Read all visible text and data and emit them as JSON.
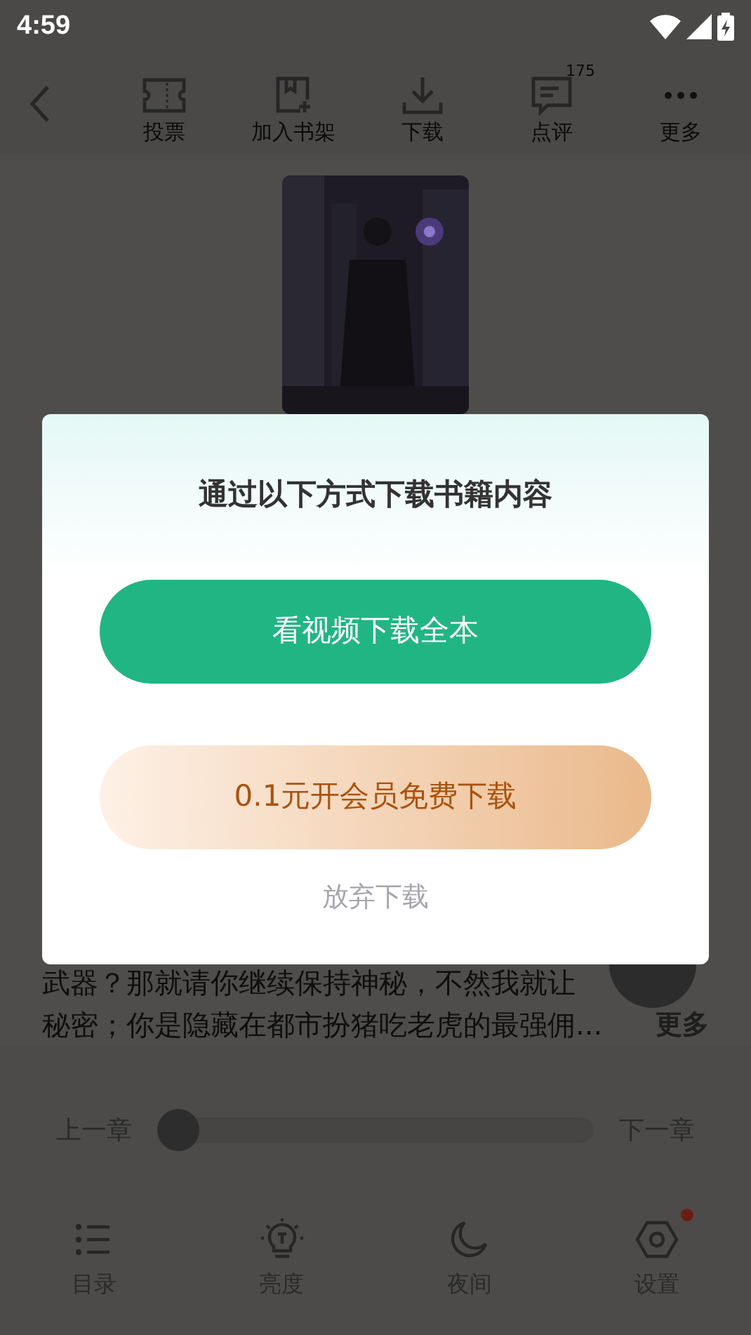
{
  "status_bar": {
    "time": "4:59"
  },
  "toolbar": {
    "actions": [
      {
        "kind": "vote",
        "label": "投票"
      },
      {
        "kind": "shelf",
        "label": "加入书架"
      },
      {
        "kind": "download",
        "label": "下载"
      },
      {
        "kind": "review",
        "label": "点评",
        "count": "175"
      },
      {
        "kind": "more",
        "label": "更多"
      }
    ]
  },
  "book": {
    "description": [
      "武器？那就请你继续保持神秘，不然我就让",
      "秘密；你是隐藏在都市扮猪吃老虎的最强佣..."
    ],
    "more": "更多"
  },
  "chapter_nav": {
    "prev": "上一章",
    "next": "下一章",
    "progress": {
      "level": 0
    }
  },
  "bottom_nav": [
    {
      "kind": "toc",
      "label": "目录",
      "badge": false
    },
    {
      "kind": "brightness",
      "label": "亮度",
      "badge": false
    },
    {
      "kind": "night",
      "label": "夜间",
      "badge": false
    },
    {
      "kind": "settings",
      "label": "设置",
      "badge": true
    }
  ],
  "dialog": {
    "title": "通过以下方式下载书籍内容",
    "buttons": [
      {
        "kind": "primary",
        "label": "看视频下载全本"
      },
      {
        "kind": "vip",
        "label": "0.1元开会员免费下载"
      }
    ],
    "cancel": "放弃下载"
  }
}
